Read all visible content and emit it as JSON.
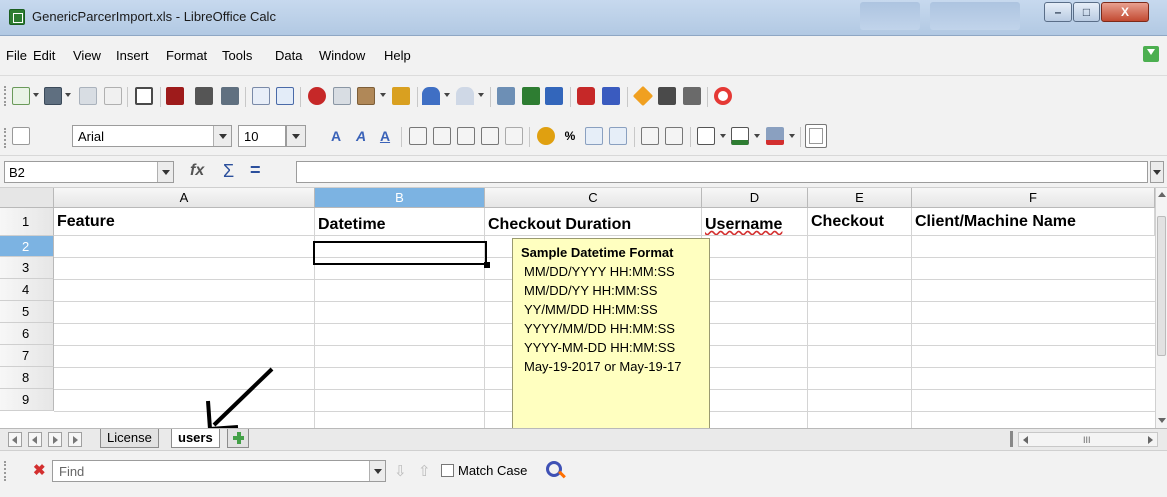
{
  "window": {
    "title": "GenericParcerImport.xls - LibreOffice Calc",
    "buttons": {
      "minimize": "–",
      "maximize": "□",
      "close": "X"
    }
  },
  "menu": [
    "File",
    "Edit",
    "View",
    "Insert",
    "Format",
    "Tools",
    "Data",
    "Window",
    "Help"
  ],
  "formatting": {
    "font_name": "Arial",
    "font_size": "10"
  },
  "formula_bar": {
    "cell_ref": "B2",
    "fx": "fx",
    "sigma": "Σ",
    "equals": "=",
    "content": ""
  },
  "sheet": {
    "columns": [
      "A",
      "B",
      "C",
      "D",
      "E",
      "F"
    ],
    "selected_column": "B",
    "rows": [
      "1",
      "2",
      "3",
      "4",
      "5",
      "6",
      "7",
      "8",
      "9"
    ],
    "selected_row": "2",
    "header_row": [
      "Feature",
      "Datetime",
      "Checkout Duration",
      "Username",
      "Checkout",
      "Client/Machine Name"
    ],
    "active_cell": "B2"
  },
  "tooltip": {
    "title": "Sample Datetime Format",
    "lines": [
      "MM/DD/YYYY  HH:MM:SS",
      "MM/DD/YY HH:MM:SS",
      "YY/MM/DD HH:MM:SS",
      "YYYY/MM/DD HH:MM:SS",
      "YYYY-MM-DD HH:MM:SS",
      "May-19-2017 or May-19-17"
    ]
  },
  "tabs": [
    "License",
    "users"
  ],
  "active_tab": "users",
  "find": {
    "placeholder": "Find",
    "match_case": "Match Case"
  }
}
